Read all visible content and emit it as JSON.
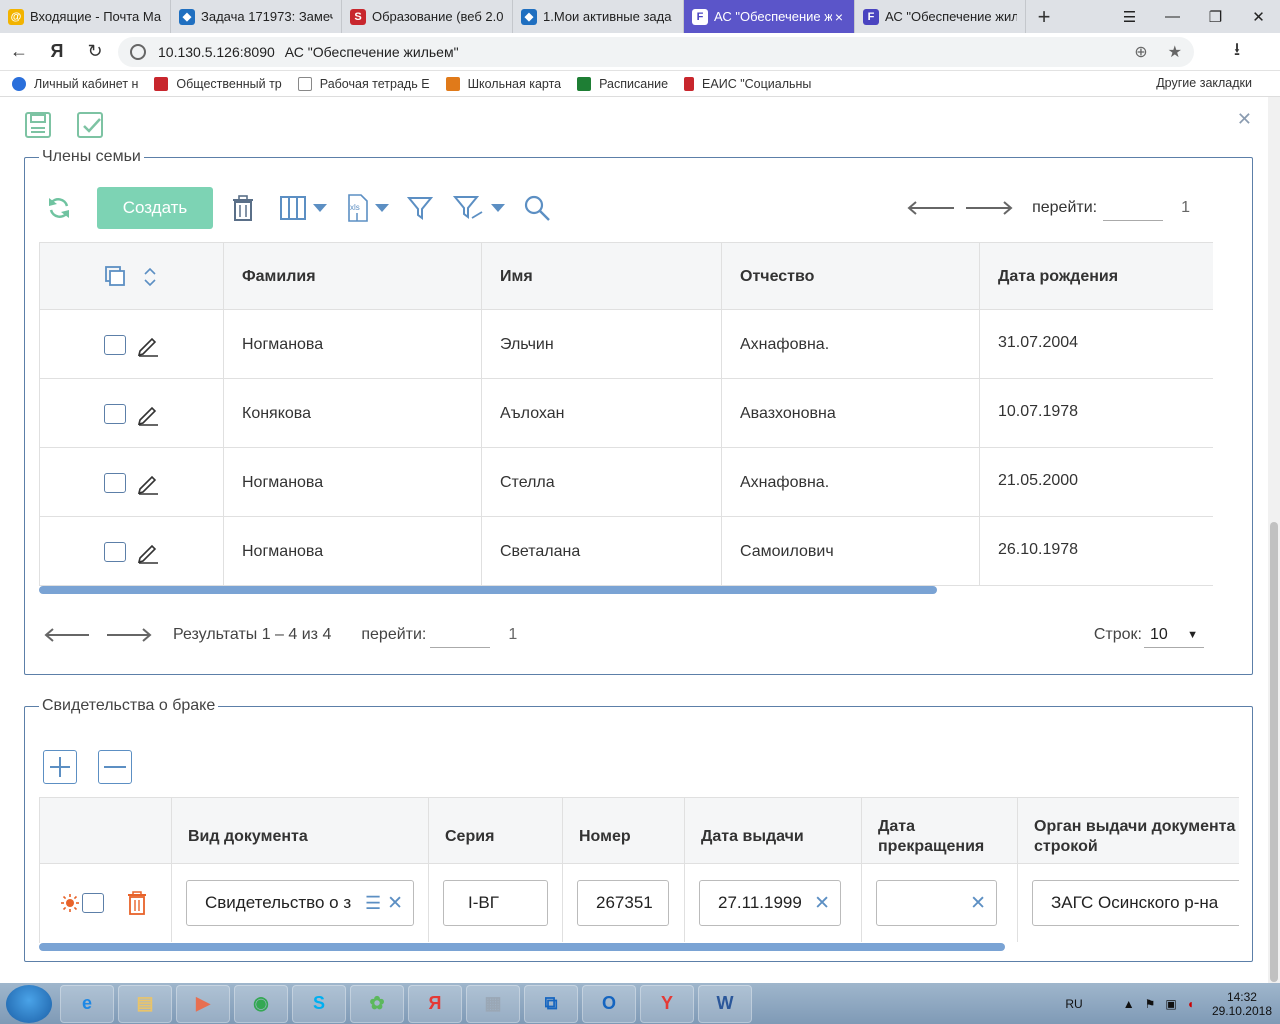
{
  "browser": {
    "tabs": [
      {
        "title": "Входящие - Почта Ма",
        "color": "#f2b300",
        "glyph": "@",
        "active": false
      },
      {
        "title": "Задача 171973: Замеч",
        "color": "#1f6fc0",
        "glyph": "◆",
        "active": false
      },
      {
        "title": "Образование (веб 2.0",
        "color": "#c8262d",
        "glyph": "S",
        "active": false
      },
      {
        "title": "1.Мои активные зада",
        "color": "#1f6fc0",
        "glyph": "◆",
        "active": false
      },
      {
        "title": "АС \"Обеспечение ж",
        "color": "#4a44c0",
        "glyph": "F",
        "active": true
      },
      {
        "title": "АС \"Обеспечение жил",
        "color": "#4a44c0",
        "glyph": "F",
        "active": false
      }
    ],
    "address_host": "10.130.5.126:8090",
    "page_title": "АС \"Обеспечение жильем\"",
    "bookmarks": [
      {
        "label": "Личный кабинет н",
        "color": "#2a6fdb"
      },
      {
        "label": "Общественный тр",
        "color": "#c8262d"
      },
      {
        "label": "Рабочая тетрадь Е",
        "color": "#888888"
      },
      {
        "label": "Школьная карта",
        "color": "#e07a1a"
      },
      {
        "label": "Расписание",
        "color": "#1e7e34"
      },
      {
        "label": "ЕАИС \"Социальны",
        "color": "#c8262d"
      }
    ],
    "other_bookmarks": "Другие закладки"
  },
  "family": {
    "legend": "Члены семьи",
    "create_label": "Создать",
    "goto_label": "перейти:",
    "page_number": "1",
    "columns": [
      "Фамилия",
      "Имя",
      "Отчество",
      "Дата рождения"
    ],
    "rows": [
      {
        "last": "Ногманова",
        "first": "Эльчин",
        "middle": "Ахнафовна.",
        "birth": "31.07.2004"
      },
      {
        "last": "Конякова",
        "first": "Аълохан",
        "middle": "Авазхоновна",
        "birth": "10.07.1978"
      },
      {
        "last": "Ногманова",
        "first": "Стелла",
        "middle": "Ахнафовна.",
        "birth": "21.05.2000"
      },
      {
        "last": "Ногманова",
        "first": "Светалана",
        "middle": "Самоилович",
        "birth": "26.10.1978"
      }
    ],
    "results_text": "Результаты 1 – 4 из 4",
    "rows_label": "Строк:",
    "rows_per_page": "10"
  },
  "marriage": {
    "legend": "Свидетельства о браке",
    "columns": [
      "Вид документа",
      "Серия",
      "Номер",
      "Дата выдачи",
      "Дата прекращения",
      "Орган выдачи документа строкой"
    ],
    "row": {
      "doc_type": "Свидетельство о з",
      "series": "I-ВГ",
      "number": "267351",
      "issue_date": "27.11.1999",
      "end_date": "",
      "authority": "ЗАГС Осинского р-на"
    }
  },
  "taskbar": {
    "lang": "RU",
    "time": "14:32",
    "date": "29.10.2018",
    "apps": [
      {
        "name": "ie",
        "color": "#1e88e5",
        "glyph": "e"
      },
      {
        "name": "explorer",
        "color": "#e9c46a",
        "glyph": "▤"
      },
      {
        "name": "media",
        "color": "#e76f51",
        "glyph": "▶"
      },
      {
        "name": "chrome",
        "color": "#34a853",
        "glyph": "◉"
      },
      {
        "name": "skype",
        "color": "#00aff0",
        "glyph": "S"
      },
      {
        "name": "icq",
        "color": "#5cb85c",
        "glyph": "✿"
      },
      {
        "name": "yandex-app",
        "color": "#e53935",
        "glyph": "Я"
      },
      {
        "name": "calculator",
        "color": "#9aa7b5",
        "glyph": "▦"
      },
      {
        "name": "network",
        "color": "#1565c0",
        "glyph": "⧉"
      },
      {
        "name": "outlook",
        "color": "#1565c0",
        "glyph": "O"
      },
      {
        "name": "yandex-browser",
        "color": "#e53935",
        "glyph": "Y"
      },
      {
        "name": "word",
        "color": "#2b579a",
        "glyph": "W"
      }
    ]
  }
}
